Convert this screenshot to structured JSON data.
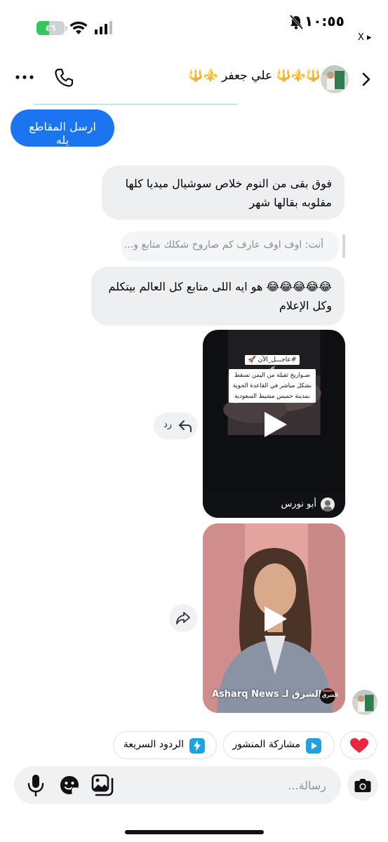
{
  "status_bar": {
    "time": "١٠:٥٥",
    "battery_level": "٤٦",
    "battery_fraction": 0.46,
    "back_app_label": "X ▸",
    "icons": [
      "battery-charging-icon",
      "wifi-icon",
      "signal-icon",
      "bell-off-icon"
    ]
  },
  "header": {
    "contact_name": "🔱⚜️🔱 علي جعفر ⚜️🔱",
    "icons": [
      "more-icon",
      "phone-icon",
      "chevron-right-icon"
    ]
  },
  "messages": {
    "sent_1": "ارسل المقاطع يله",
    "recv_1": "فوق بقى من النوم خلاص سوشيال ميديا كلها مقلوبه بقالها شهر",
    "reply_quote": "أنت: اوف اوف عارف كم صاروخ شكلك متابع و...",
    "recv_2": "😂😂😂😂😂 هو ايه اللى متابع كل العالم بيتكلم وكل الإعلام"
  },
  "media_1": {
    "headline_chip": "#عاجـــل_الآن 🚀🚀",
    "headline_text": "صـواريخ ثقيلة من اليمن تسقط بشكل مباشر في القاعدة الجوية بمدينة خميس مشيط السعودية",
    "author": "أبو نورس"
  },
  "media_2": {
    "caption": "Asharq News الشرق لـ...",
    "logo_text": "الشرق"
  },
  "side_actions": {
    "reply_label": "رد"
  },
  "quick_actions": {
    "share_post": "مشاركة المنشور",
    "quick_replies": "الردود السريعة"
  },
  "composer": {
    "placeholder": "رسالة..."
  },
  "colors": {
    "accent": "#1b74f0",
    "bubble_received": "#eeeff1",
    "heart": "#e8283f",
    "chip_icon": "#1fa2e0"
  }
}
